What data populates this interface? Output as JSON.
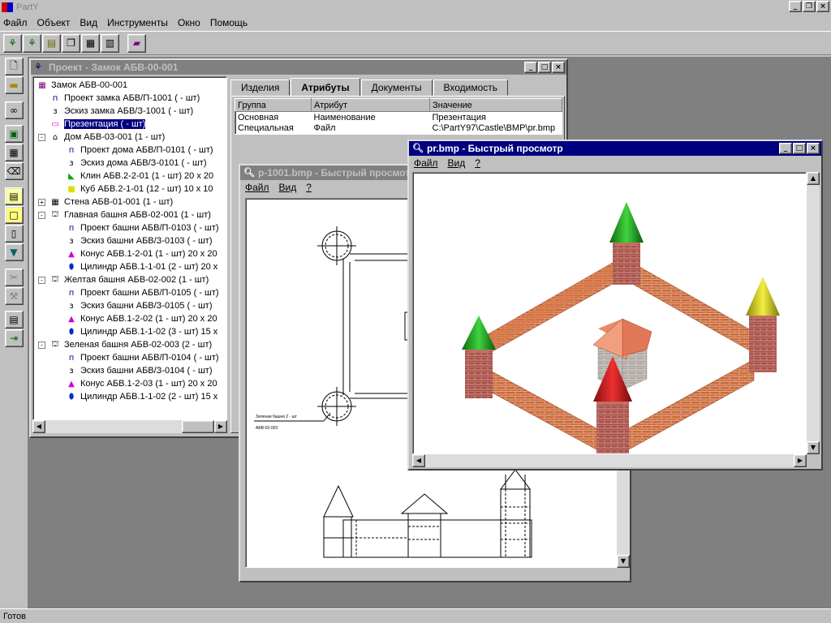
{
  "app": {
    "title": "PartY"
  },
  "menu": [
    "Файл",
    "Объект",
    "Вид",
    "Инструменты",
    "Окно",
    "Помощь"
  ],
  "toolbar_icons": [
    "tree-icon",
    "tree-alt-icon",
    "tree-folder-icon",
    "windows-icon",
    "grid-icon",
    "table-icon",
    "book-icon"
  ],
  "vtoolbar_icons": [
    "new-document-icon",
    "open-folder-icon",
    "binoculars-icon",
    "object-icon",
    "edit-grid-icon",
    "eraser-icon",
    "page-icon",
    "page-yellow-icon",
    "document-icon",
    "filter-icon",
    "cut-icon",
    "tools-icon",
    "properties-icon",
    "exit-icon"
  ],
  "project_window": {
    "title": "Проект - Замок   АБВ-00-001",
    "tree": [
      {
        "label": "Замок  АБВ-00-001",
        "icon": "castle-icon",
        "level": 0
      },
      {
        "label": "Проект замка  АБВ/П-1001  ( - шт)",
        "icon": "doc-p-icon",
        "level": 1
      },
      {
        "label": "Эскиз замка  АБВ/З-1001  ( - шт)",
        "icon": "doc-z-icon",
        "level": 1
      },
      {
        "label": "Презентация     ( - шт)",
        "icon": "presentation-icon",
        "level": 1,
        "selected": true
      },
      {
        "label": "Дом  АБВ-03-001  (1 - шт)",
        "icon": "house-icon",
        "level": 1,
        "expander": "-"
      },
      {
        "label": "Проект дома  АБВ/П-0101  ( - шт)",
        "icon": "doc-p-icon",
        "level": 2
      },
      {
        "label": "Эскиз дома  АБВ/З-0101  ( - шт)",
        "icon": "doc-z-icon",
        "level": 2
      },
      {
        "label": "Клин   АБВ.2-2-01  (1 - шт)   20 x 20",
        "icon": "wedge-icon",
        "level": 2
      },
      {
        "label": "Куб   АБВ.2-1-01  (12 - шт)   10 x 10",
        "icon": "cube-icon",
        "level": 2
      },
      {
        "label": "Стена   АБВ-01-001  (1 - шт)",
        "icon": "wall-icon",
        "level": 1,
        "expander": "+"
      },
      {
        "label": "Главная башня  АБВ-02-001  (1 - шт)",
        "icon": "tower-icon",
        "level": 1,
        "expander": "-"
      },
      {
        "label": "Проект башни  АБВ/П-0103  ( - шт)",
        "icon": "doc-p-icon",
        "level": 2
      },
      {
        "label": "Эскиз башни  АБВ/З-0103  ( - шт)",
        "icon": "doc-z-icon",
        "level": 2
      },
      {
        "label": "Конус   АБВ.1-2-01  (1 - шт)   20 x 20",
        "icon": "cone-icon",
        "level": 2
      },
      {
        "label": "Цилиндр   АБВ.1-1-01  (2 - шт)   20 x",
        "icon": "cylinder-icon",
        "level": 2
      },
      {
        "label": "Желтая башня  АБВ-02-002  (1 - шт)",
        "icon": "tower-icon",
        "level": 1,
        "expander": "-"
      },
      {
        "label": "Проект башни  АБВ/П-0105  ( - шт)",
        "icon": "doc-p-icon",
        "level": 2
      },
      {
        "label": "Эскиз башни  АБВ/З-0105  ( - шт)",
        "icon": "doc-z-icon",
        "level": 2
      },
      {
        "label": "Конус   АБВ.1-2-02  (1 - шт)   20 x 20",
        "icon": "cone-icon",
        "level": 2
      },
      {
        "label": "Цилиндр   АБВ.1-1-02  (3 - шт)   15 x",
        "icon": "cylinder-icon",
        "level": 2
      },
      {
        "label": "Зеленая башня  АБВ-02-003  (2 - шт)",
        "icon": "tower-icon",
        "level": 1,
        "expander": "-"
      },
      {
        "label": "Проект башни  АБВ/П-0104  ( - шт)",
        "icon": "doc-p-icon",
        "level": 2
      },
      {
        "label": "Эскиз башни  АБВ/З-0104  ( - шт)",
        "icon": "doc-z-icon",
        "level": 2
      },
      {
        "label": "Конус   АБВ.1-2-03  (1 - шт)   20 x 20",
        "icon": "cone-icon",
        "level": 2
      },
      {
        "label": "Цилиндр   АБВ.1-1-02  (2 - шт)   15 x",
        "icon": "cylinder-icon",
        "level": 2
      }
    ],
    "tabs": [
      "Изделия",
      "Атрибуты",
      "Документы",
      "Входимость"
    ],
    "active_tab": "Атрибуты",
    "table": {
      "headers": [
        "Группа",
        "Атрибут",
        "Значение"
      ],
      "rows": [
        [
          "Основная",
          "Наименование",
          "Презентация"
        ],
        [
          "Специальная",
          "Файл",
          "C:\\PartY97\\Castle\\BMP\\pr.bmp"
        ]
      ]
    }
  },
  "drawing_window": {
    "title": "p-1001.bmp - Быстрый просмотр",
    "menu": [
      "Файл",
      "Вид",
      "?"
    ],
    "annotation_line1": "Зеленая башня 2 - шт",
    "annotation_line2": "АБВ-02-003"
  },
  "preview_window": {
    "title": "pr.bmp - Быстрый просмотр",
    "menu": [
      "Файл",
      "Вид",
      "?"
    ]
  },
  "status": {
    "text": "Готов"
  },
  "colors": {
    "title_active": "#000080",
    "title_inactive": "#808080",
    "selection": "#000080",
    "brick": "#c8683a",
    "cone_green": "#1cae1c",
    "cone_yellow": "#d6d21a",
    "cone_red": "#d0121a"
  }
}
